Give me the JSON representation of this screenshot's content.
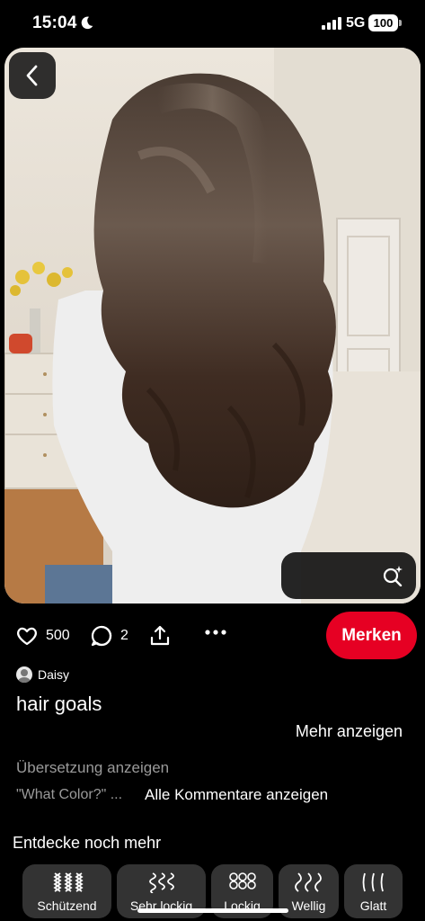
{
  "status_bar": {
    "time": "15:04",
    "network": "5G",
    "battery": "100"
  },
  "pin": {
    "likes": "500",
    "comments": "2",
    "save_label": "Merken",
    "author": "Daisy",
    "title": "hair goals",
    "show_more": "Mehr anzeigen",
    "translate": "Übersetzung anzeigen",
    "comment_preview": "\"What Color?\" ...",
    "all_comments": "Alle Kommentare anzeigen"
  },
  "discover": {
    "title": "Entdecke noch mehr",
    "chips": [
      {
        "label": "Schützend"
      },
      {
        "label": "Sehr lockig"
      },
      {
        "label": "Lockig"
      },
      {
        "label": "Wellig"
      },
      {
        "label": "Glatt"
      }
    ]
  },
  "colors": {
    "accent": "#e60023",
    "background": "#000000"
  },
  "icons": [
    "moon-icon",
    "back-arrow-icon",
    "visual-search-icon",
    "heart-icon",
    "comment-icon",
    "share-icon",
    "more-icon"
  ]
}
